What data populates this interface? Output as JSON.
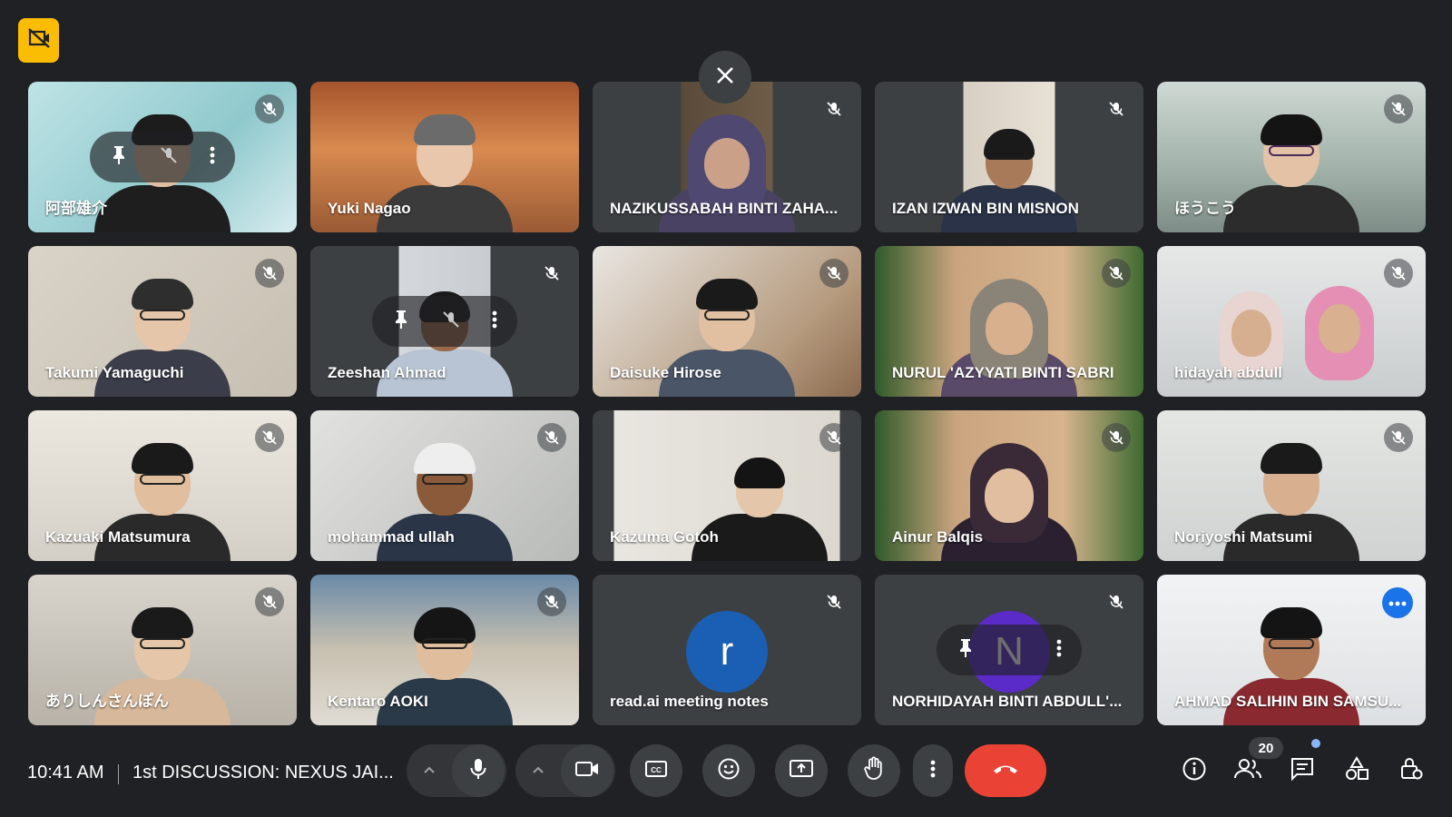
{
  "meeting": {
    "time": "10:41 AM",
    "title": "1st DISCUSSION: NEXUS JAI...",
    "participant_count": "20",
    "close_label": "×"
  },
  "participants": [
    {
      "name": "阿部雄介"
    },
    {
      "name": "Yuki Nagao"
    },
    {
      "name": "NAZIKUSSABAH BINTI ZAHA..."
    },
    {
      "name": "IZAN IZWAN BIN MISNON"
    },
    {
      "name": "ほうこう"
    },
    {
      "name": "Takumi Yamaguchi"
    },
    {
      "name": "Zeeshan Ahmad"
    },
    {
      "name": "Daisuke Hirose"
    },
    {
      "name": "NURUL 'AZYYATI BINTI SABRI"
    },
    {
      "name": "hidayah abdull"
    },
    {
      "name": "Kazuaki Matsumura"
    },
    {
      "name": "mohammad ullah"
    },
    {
      "name": "Kazuma Gotoh"
    },
    {
      "name": "Ainur Balqis"
    },
    {
      "name": "Noriyoshi Matsumi"
    },
    {
      "name": "ありしんさんぽん"
    },
    {
      "name": "Kentaro AOKI"
    },
    {
      "name": "read.ai meeting notes",
      "avatar_letter": "r"
    },
    {
      "name": "NORHIDAYAH BINTI ABDULL'...",
      "avatar_letter": "N"
    },
    {
      "name": "AHMAD SALIHIN BIN SAMSU..."
    }
  ],
  "colors": {
    "background": "#202124",
    "tile": "#3c4043",
    "end_call": "#ea4335",
    "recording": "#fbbc04",
    "accent": "#8ab4f8",
    "avatar_r": "#1a5fb4",
    "avatar_n": "#5b2bc9"
  },
  "icons": {
    "recording": "recording-off-icon",
    "mic_muted": "mic-off-icon",
    "pin": "pin-icon",
    "more": "more-vert-icon",
    "caption": "closed-caption-icon",
    "emoji": "emoji-icon",
    "present": "present-screen-icon",
    "hand": "raise-hand-icon",
    "end_call": "call-end-icon",
    "info": "info-icon",
    "people": "people-icon",
    "chat": "chat-icon",
    "activities": "activities-icon",
    "host_controls": "host-controls-icon"
  }
}
